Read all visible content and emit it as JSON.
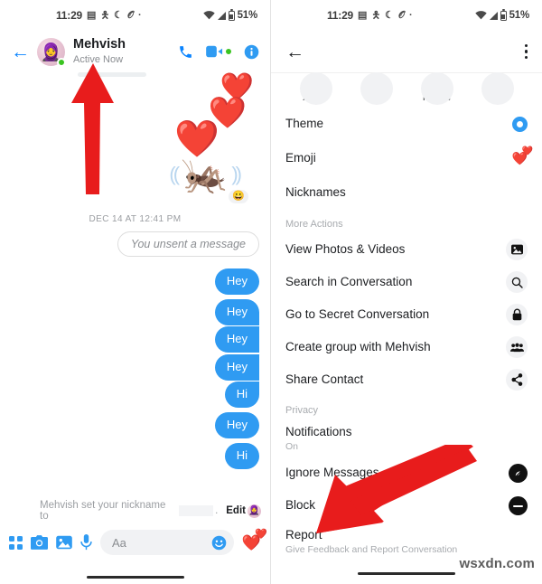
{
  "status_bar": {
    "time": "11:29",
    "notification_icons": [
      "book-icon",
      "person-icon",
      "moon-icon",
      "spiral-icon",
      "dot-icon"
    ],
    "wifi": "wifi-icon",
    "signal": "signal-icon",
    "battery_level": "51%"
  },
  "chat": {
    "back_label": "←",
    "contact_name": "Mehvish",
    "presence": "Active Now",
    "actions": [
      {
        "name": "audio-call",
        "icon": "phone-icon"
      },
      {
        "name": "video-call",
        "icon": "video-camera-icon"
      },
      {
        "name": "conversation-info",
        "icon": "info-icon"
      }
    ],
    "stickers": {
      "heart_small": "❤️",
      "heart_medium": "❤️",
      "heart_large": "❤️",
      "cricket": "🦗",
      "sound_left": "((",
      "sound_right": "))",
      "reaction": "😀"
    },
    "day_stamp": "DEC 14 AT 12:41 PM",
    "unsent_text": "You unsent a message",
    "messages": [
      {
        "text": "Hey",
        "group": "a"
      },
      {
        "text": "Hey",
        "group": "b"
      },
      {
        "text": "Hey",
        "group": "b"
      },
      {
        "text": "Hey",
        "group": "b"
      },
      {
        "text": "Hi",
        "group": "b"
      },
      {
        "text": "Hey",
        "group": "c"
      },
      {
        "text": "Hi",
        "group": "d"
      }
    ],
    "nickname_bar": {
      "text": "Mehvish set your nickname to",
      "suffix": ".",
      "edit_label": "Edit"
    },
    "composer": {
      "placeholder": "Aa",
      "icons": [
        "apps-grid-icon",
        "camera-icon",
        "gallery-icon",
        "microphone-icon",
        "emoji-icon",
        "heart-send-icon"
      ],
      "heart": "❤️",
      "heart_small": "❤️"
    }
  },
  "details": {
    "back_label": "←",
    "menu_icon": "kebab-menu-icon",
    "quick_actions": [
      {
        "label": "Audio",
        "icon": "phone-icon"
      },
      {
        "label": "Video",
        "icon": "video-camera-icon"
      },
      {
        "label": "Profile",
        "icon": "profile-icon"
      },
      {
        "label": "Mute",
        "icon": "bell-mute-icon"
      }
    ],
    "top_rows": [
      {
        "title": "Theme",
        "icon": "theme-color-circle",
        "accent": "#2f9bf2"
      },
      {
        "title": "Emoji",
        "icon": "hearts-emoji",
        "glyph": "❤️",
        "glyph_small": "❤️"
      },
      {
        "title": "Nicknames",
        "icon": "none"
      }
    ],
    "more_actions_header": "More Actions",
    "more_actions": [
      {
        "title": "View Photos & Videos",
        "icon": "image-icon"
      },
      {
        "title": "Search in Conversation",
        "icon": "search-icon"
      },
      {
        "title": "Go to Secret Conversation",
        "icon": "lock-icon"
      },
      {
        "title": "Create group with Mehvish",
        "icon": "group-icon"
      },
      {
        "title": "Share Contact",
        "icon": "share-icon"
      }
    ],
    "privacy_header": "Privacy",
    "privacy_rows": [
      {
        "title": "Notifications",
        "subtitle": "On",
        "icon": "none"
      },
      {
        "title": "Ignore Messages",
        "subtitle": "",
        "icon": "ignore-icon"
      },
      {
        "title": "Block",
        "subtitle": "",
        "icon": "block-icon"
      },
      {
        "title": "Report",
        "subtitle": "Give Feedback and Report Conversation",
        "icon": "none"
      }
    ]
  },
  "watermark": "wsxdn.com",
  "annotations": {
    "arrow_color": "#e81c1c",
    "left_arrow_target": "chat-header",
    "right_arrow_target": "block-row"
  }
}
